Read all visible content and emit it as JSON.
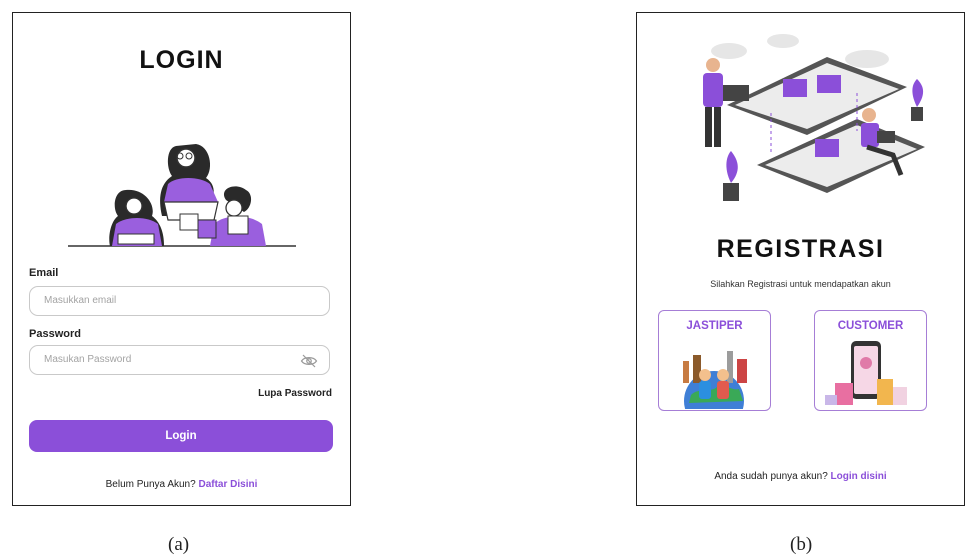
{
  "login": {
    "title": "LOGIN",
    "email_label": "Email",
    "email_placeholder": "Masukkan email",
    "password_label": "Password",
    "password_placeholder": "Masukan Password",
    "forgot_label": "Lupa Password",
    "login_button": "Login",
    "footer_text": "Belum Punya Akun?",
    "footer_link": "Daftar Disini"
  },
  "register": {
    "title": "REGISTRASI",
    "subtitle": "Silahkan Registrasi untuk mendapatkan akun",
    "cards": [
      {
        "label": "JASTIPER",
        "icon": "world-travel-icon"
      },
      {
        "label": "CUSTOMER",
        "icon": "phone-shopping-icon"
      }
    ],
    "footer_text": "Anda sudah punya akun?",
    "footer_link": "Login disini"
  },
  "captions": [
    "(a)",
    "(b)"
  ],
  "colors": {
    "accent": "#8b4fd9",
    "card_border": "#a67ed6",
    "input_border": "#c9c9c9"
  }
}
